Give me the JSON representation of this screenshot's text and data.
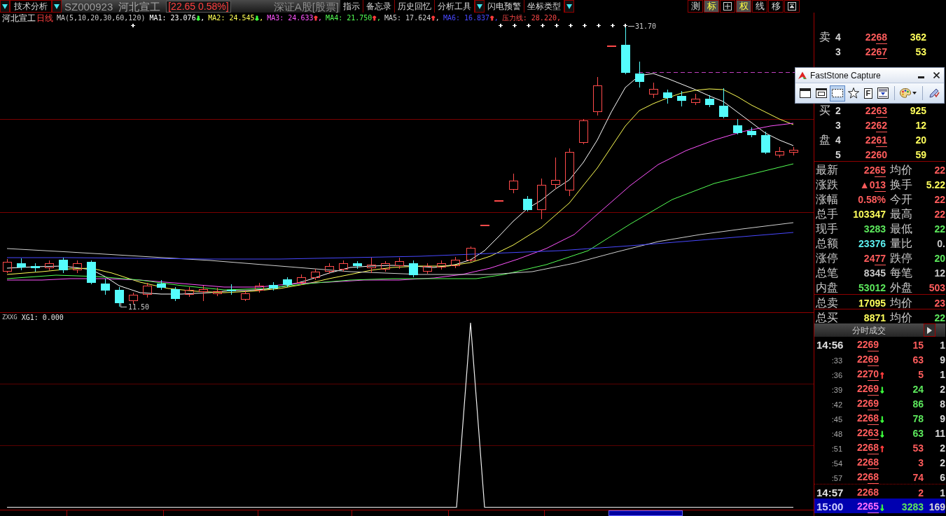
{
  "top_bar": {
    "analysis_menu": "技术分析",
    "stock_title": {
      "code": "SZ000923",
      "name": "河北宣工",
      "quote": "[22.65 0.58%]",
      "market": "深证A股[股票]"
    },
    "menus": [
      {
        "label": "指示",
        "dropdown": false
      },
      {
        "label": "备忘录",
        "dropdown": false
      },
      {
        "label": "历史回忆",
        "dropdown": false
      },
      {
        "label": "分析工具",
        "dropdown": true
      },
      {
        "label": "闪电预警",
        "dropdown": false
      },
      {
        "label": "坐标类型",
        "dropdown": true
      }
    ],
    "tools": [
      {
        "kind": "text",
        "label": "测",
        "selected": false
      },
      {
        "kind": "text",
        "label": "标",
        "selected": true
      },
      {
        "kind": "crosshair",
        "selected": false
      },
      {
        "kind": "text",
        "label": "权",
        "selected": true
      },
      {
        "kind": "text",
        "label": "线",
        "selected": false
      },
      {
        "kind": "text",
        "label": "移",
        "selected": false
      },
      {
        "kind": "restore",
        "selected": false
      }
    ]
  },
  "chart": {
    "stock_name": "河北宣工",
    "period": "日线",
    "ma_params": "MA(5,10,20,30,60,120)",
    "indicators": [
      {
        "label": "MA1: 23.076",
        "arrow": {
          "text": "↓",
          "color": "#3cff3c"
        },
        "color": "#ffffff",
        "separator": ","
      },
      {
        "label": "MA2: 24.545",
        "arrow": {
          "text": "↓",
          "color": "#3cff3c"
        },
        "color": "#ffff54",
        "separator": ","
      },
      {
        "label": "MA3: 24.633",
        "arrow": {
          "text": "↑",
          "color": "#ff3c3c"
        },
        "color": "#ff54ff",
        "separator": ","
      },
      {
        "label": "MA4: 21.750",
        "arrow": {
          "text": "↑",
          "color": "#ff3c3c"
        },
        "color": "#54ff54",
        "separator": ","
      },
      {
        "label": "MA5: 17.624",
        "arrow": {
          "text": "↑",
          "color": "#ff3c3c"
        },
        "color": "#d0d0d0",
        "separator": ","
      },
      {
        "label": "MA6: 16.837",
        "arrow": {
          "text": "↑",
          "color": "#ff3c3c"
        },
        "color": "#4848ff",
        "separator": ","
      },
      {
        "label": "压力线: 28.220",
        "color": "#ff4848",
        "separator": ","
      }
    ],
    "high_label": "31.70",
    "low_label": "11.50"
  },
  "indicator_panel": {
    "name": "ZXXG",
    "reading": "XG1: 0.000"
  },
  "order_book": {
    "sell": [
      {
        "tag": "卖",
        "level": "4",
        "price": "2268",
        "volume": "362"
      },
      {
        "level": "3",
        "price": "2267",
        "volume": "53"
      }
    ],
    "buy": [
      {
        "tag": "买",
        "level": "2",
        "price": "2263",
        "volume": "925"
      },
      {
        "level": "3",
        "price": "2262",
        "volume": "12"
      },
      {
        "tag": "盘",
        "level": "4",
        "price": "2261",
        "volume": "20"
      },
      {
        "level": "5",
        "price": "2260",
        "volume": "59"
      }
    ]
  },
  "quote": [
    {
      "cells": [
        {
          "label": "最新",
          "value": "2265",
          "color": "#ff5c5c",
          "underline": true
        },
        {
          "label": "均价",
          "value": "22",
          "color": "#ff5c5c",
          "underline": false
        }
      ]
    },
    {
      "cells": [
        {
          "label": "涨跌",
          "value": "▲013",
          "color": "#ff5c5c",
          "underline": true
        },
        {
          "label": "换手",
          "value": "5.22",
          "color": "#ffff5c",
          "underline": false
        }
      ]
    },
    {
      "cells": [
        {
          "label": "涨幅",
          "value": "0.58%",
          "color": "#ff5c5c",
          "underline": false
        },
        {
          "label": "今开",
          "value": "22",
          "color": "#ff5c5c",
          "underline": false
        }
      ]
    },
    {
      "cells": [
        {
          "label": "总手",
          "value": "103347",
          "color": "#ffff5c",
          "underline": false
        },
        {
          "label": "最高",
          "value": "22",
          "color": "#ff5c5c",
          "underline": false
        }
      ]
    },
    {
      "cells": [
        {
          "label": "现手",
          "value": "3283",
          "color": "#5ce85c",
          "underline": false
        },
        {
          "label": "最低",
          "value": "22",
          "color": "#5ce85c",
          "underline": false
        }
      ]
    },
    {
      "cells": [
        {
          "label": "总额",
          "value": "23376",
          "color": "#5cf0f0",
          "underline": false
        },
        {
          "label": "量比",
          "value": "0.",
          "color": "#c8c8c8",
          "underline": false
        }
      ]
    },
    {
      "cells": [
        {
          "label": "涨停",
          "value": "2477",
          "color": "#ff5c5c",
          "underline": true
        },
        {
          "label": "跌停",
          "value": "20",
          "color": "#5ce85c",
          "underline": false
        }
      ]
    },
    {
      "cells": [
        {
          "label": "总笔",
          "value": "8345",
          "color": "#c8c8c8",
          "underline": false
        },
        {
          "label": "每笔",
          "value": "12",
          "color": "#c8c8c8",
          "underline": false
        }
      ]
    },
    {
      "cells": [
        {
          "label": "内盘",
          "value": "53012",
          "color": "#5ce85c",
          "underline": false
        },
        {
          "label": "外盘",
          "value": "503",
          "color": "#ff5c5c",
          "underline": false
        }
      ]
    },
    {
      "cells": [
        {
          "label": "总卖",
          "value": "17095",
          "color": "#ffff5c",
          "underline": false
        },
        {
          "label": "均价",
          "value": "23",
          "color": "#ff5c5c",
          "underline": false
        }
      ]
    },
    {
      "cells": [
        {
          "label": "总买",
          "value": "8871",
          "color": "#ffff5c",
          "underline": false
        },
        {
          "label": "均价",
          "value": "22",
          "color": "#5ce85c",
          "underline": false
        }
      ]
    }
  ],
  "ticks": {
    "header": "分时成交",
    "rows": [
      {
        "time": "14:56",
        "kind": "minute",
        "price": "2269",
        "volume": "15",
        "color": "#ff5c5c",
        "count": "1",
        "selected": false
      },
      {
        "time": ":33",
        "kind": "second",
        "price": "2269",
        "volume": "63",
        "color": "#ff5c5c",
        "count": "9",
        "selected": false
      },
      {
        "time": ":36",
        "kind": "second",
        "price": "2270",
        "arrow": {
          "text": "↑",
          "color": "#ff3c3c"
        },
        "volume": "5",
        "color": "#ff5c5c",
        "count": "1",
        "selected": false
      },
      {
        "time": ":39",
        "kind": "second",
        "price": "2269",
        "arrow": {
          "text": "↓",
          "color": "#3cff3c"
        },
        "volume": "24",
        "color": "#5ce85c",
        "count": "2",
        "selected": false
      },
      {
        "time": ":42",
        "kind": "second",
        "price": "2269",
        "volume": "86",
        "color": "#5ce85c",
        "count": "8",
        "selected": false
      },
      {
        "time": ":45",
        "kind": "second",
        "price": "2268",
        "arrow": {
          "text": "↓",
          "color": "#3cff3c"
        },
        "volume": "78",
        "color": "#5ce85c",
        "count": "9",
        "selected": false
      },
      {
        "time": ":48",
        "kind": "second",
        "price": "2263",
        "arrow": {
          "text": "↓",
          "color": "#3cff3c"
        },
        "volume": "63",
        "color": "#5ce85c",
        "count": "11",
        "selected": false
      },
      {
        "time": ":51",
        "kind": "second",
        "price": "2268",
        "arrow": {
          "text": "↑",
          "color": "#ff3c3c"
        },
        "volume": "53",
        "color": "#ff5c5c",
        "count": "2",
        "selected": false
      },
      {
        "time": ":54",
        "kind": "second",
        "price": "2268",
        "volume": "3",
        "color": "#ff5c5c",
        "count": "2",
        "selected": false
      },
      {
        "time": ":57",
        "kind": "second",
        "price": "2268",
        "volume": "74",
        "color": "#ff5c5c",
        "count": "6",
        "selected": false
      },
      {
        "time": "14:57",
        "kind": "minute",
        "price": "2268",
        "volume": "2",
        "color": "#ff5c5c",
        "count": "1",
        "selected": false
      },
      {
        "time": "15:00",
        "kind": "minute",
        "price": "2265",
        "arrow": {
          "text": "↓",
          "color": "#3cff3c"
        },
        "volume": "3283",
        "color": "#5ce85c",
        "count": "169",
        "selected": true
      }
    ]
  },
  "capture_window": {
    "title": "FastStone Capture",
    "tools": [
      {
        "kind": "window",
        "selected": false
      },
      {
        "kind": "window-frame",
        "selected": false
      },
      {
        "kind": "rectangle",
        "selected": true
      },
      {
        "kind": "freehand",
        "selected": false
      },
      {
        "kind": "fixed",
        "label": "F",
        "selected": false
      },
      {
        "kind": "scroll",
        "selected": false
      },
      {
        "kind": "palette",
        "selected": false
      },
      {
        "kind": "settings",
        "selected": false
      }
    ]
  }
}
